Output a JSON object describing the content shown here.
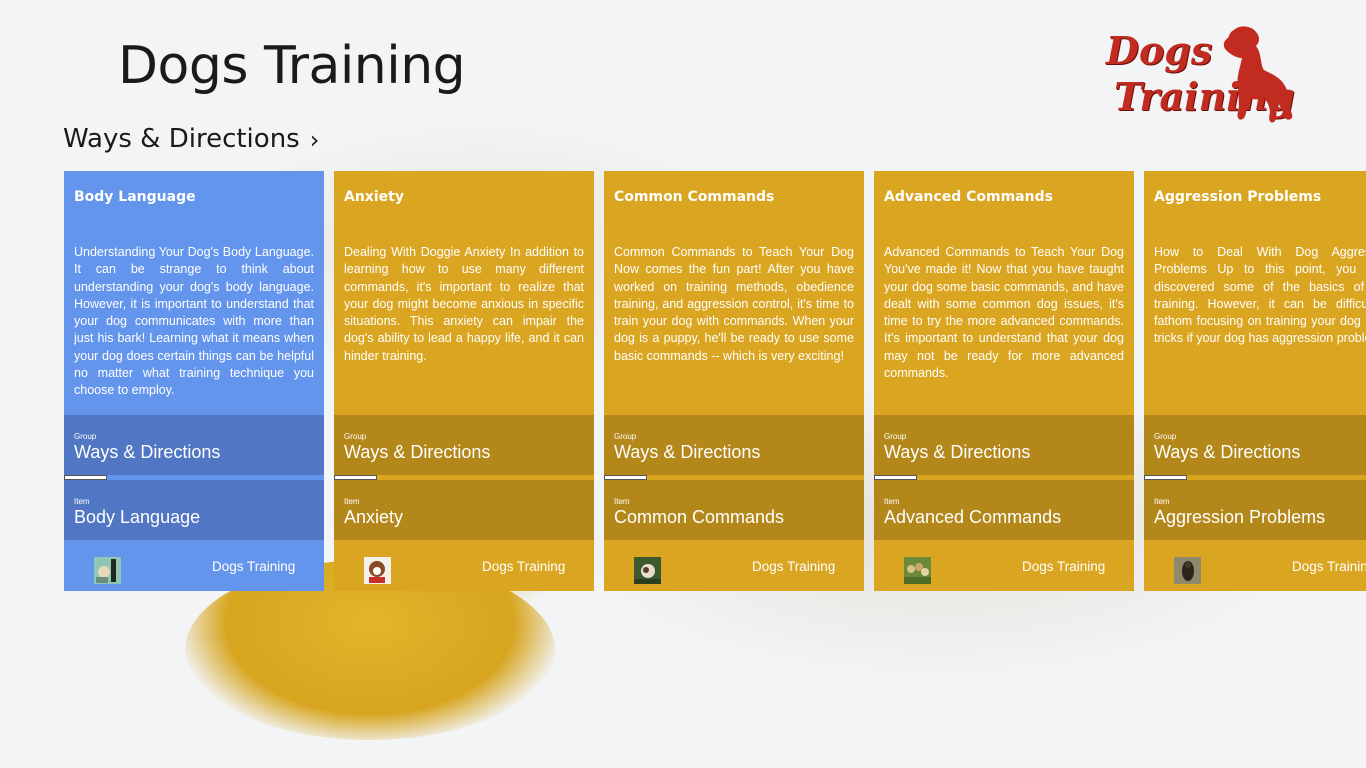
{
  "app": {
    "title": "Dogs Training"
  },
  "logo": {
    "line1": "Dogs",
    "line2": "Training"
  },
  "section": {
    "title": "Ways & Directions"
  },
  "colors": {
    "blue_tile": "#6495ed",
    "gold_tile": "#daa520",
    "logo_red": "#c22b1f"
  },
  "tiles": [
    {
      "title": "Body Language",
      "description": "Understanding Your Dog's Body Language. It can be strange to think about understanding your dog's body language. However, it is important to understand that your dog communicates with more than just his bark! Learning what it means when your dog does certain things can be helpful no matter what training technique you choose to employ.",
      "group_caption": "Group",
      "group": "Ways & Directions",
      "item_caption": "Item",
      "item": "Body Language",
      "source": "Dogs Training",
      "color": "blue"
    },
    {
      "title": "Anxiety",
      "description": "Dealing With Doggie Anxiety In addition to learning how to use many different commands, it's important to realize that your dog might become anxious in specific situations. This anxiety can impair the dog's ability to lead a happy life, and it can hinder training.",
      "group_caption": "Group",
      "group": "Ways & Directions",
      "item_caption": "Item",
      "item": "Anxiety",
      "source": "Dogs Training",
      "color": "gold"
    },
    {
      "title": "Common Commands",
      "description": "Common Commands to Teach Your Dog Now comes the fun part! After you have worked on training methods, obedience training, and aggression control, it's time to train your dog with commands. When your dog is a puppy, he'll be ready to use some basic commands -- which is very exciting!",
      "group_caption": "Group",
      "group": "Ways & Directions",
      "item_caption": "Item",
      "item": "Common Commands",
      "source": "Dogs Training",
      "color": "gold"
    },
    {
      "title": "Advanced Commands",
      "description": "Advanced Commands to Teach Your Dog You've made it! Now that you have taught your dog some basic commands, and have dealt with some common dog issues, it's time to try the more advanced commands. It's important to understand that your dog may not be ready for more advanced commands.",
      "group_caption": "Group",
      "group": "Ways & Directions",
      "item_caption": "Item",
      "item": "Advanced Commands",
      "source": "Dogs Training",
      "color": "gold"
    },
    {
      "title": "Aggression Problems",
      "description": "How to Deal With Dog Aggression Problems Up to this point, you have discovered some of the basics of dog training. However, it can be difficult to fathom focusing on training your dog to do tricks if your dog has aggression problems!",
      "group_caption": "Group",
      "group": "Ways & Directions",
      "item_caption": "Item",
      "item": "Aggression Problems",
      "source": "Dogs Training",
      "color": "gold"
    }
  ]
}
